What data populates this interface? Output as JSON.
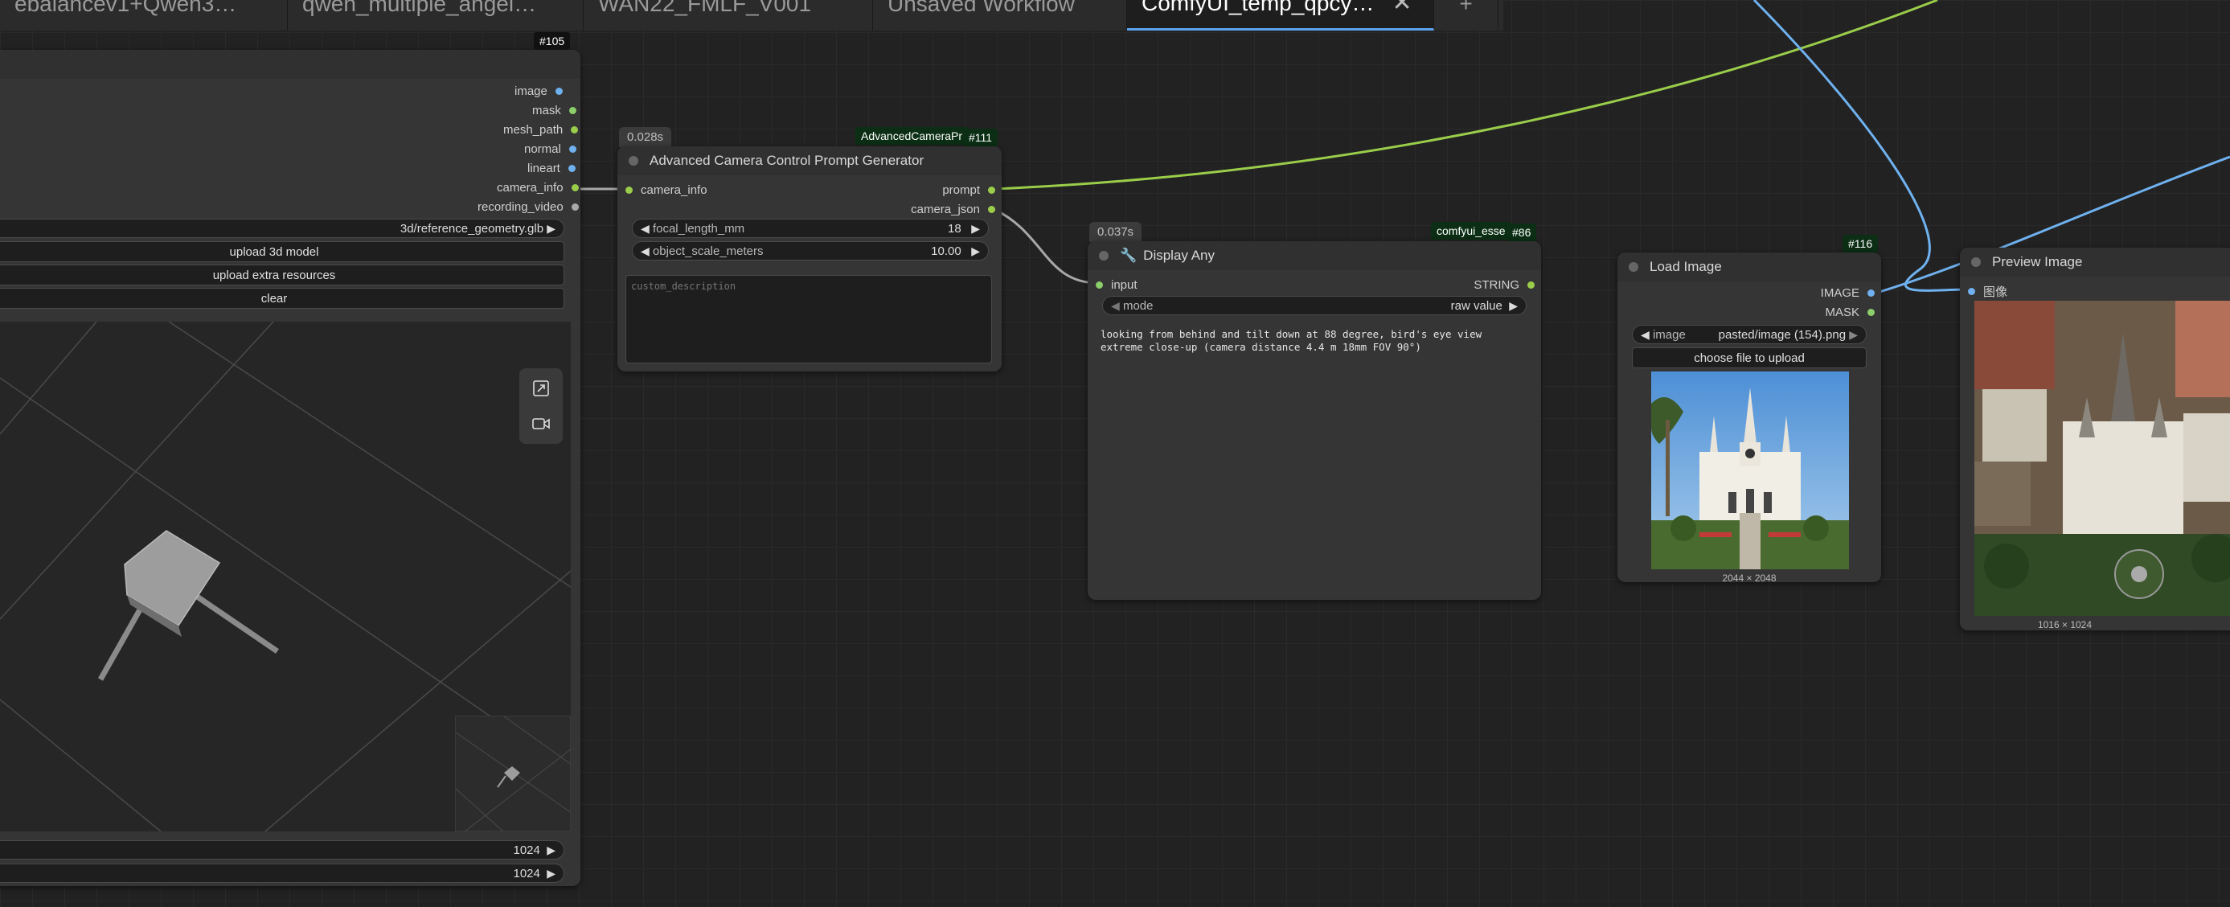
{
  "tabs": [
    {
      "label": "ebalancev1+Qwen3…"
    },
    {
      "label": "qwen_multiple_angel…"
    },
    {
      "label": "WAN22_FMLF_V001"
    },
    {
      "label": "Unsaved Workflow"
    },
    {
      "label": "ComfyUI_temp_qpcy…",
      "active": true
    }
  ],
  "tab_close": "✕",
  "tab_add": "+",
  "node105": {
    "id": "#105",
    "outputs": [
      "image",
      "mask",
      "mesh_path",
      "normal",
      "lineart",
      "camera_info",
      "recording_video"
    ],
    "model_file": "3d/reference_geometry.glb",
    "upload_model": "upload 3d model",
    "upload_extra": "upload extra resources",
    "clear": "clear",
    "width_value": "1024",
    "height_value": "1024"
  },
  "node111": {
    "timing": "0.028s",
    "type_badge": "AdvancedCameraPr",
    "id": "#111",
    "title": "Advanced Camera Control Prompt Generator",
    "input": "camera_info",
    "outputs": [
      "prompt",
      "camera_json"
    ],
    "focal_label": "focal_length_mm",
    "focal_value": "18",
    "scale_label": "object_scale_meters",
    "scale_value": "10.00",
    "textarea_placeholder": "custom_description"
  },
  "node86": {
    "timing": "0.037s",
    "type_badge": "comfyui_esse",
    "id": "#86",
    "title": "Display Any",
    "input": "input",
    "output": "STRING",
    "mode_label": "mode",
    "mode_value": "raw value",
    "text_output": "looking from behind and tilt down at 88 degree, bird's eye view extreme close-up (camera distance 4.4 m 18mm FOV 90°)"
  },
  "node116": {
    "id": "#116",
    "title": "Load Image",
    "outputs": [
      "IMAGE",
      "MASK"
    ],
    "image_label": "image",
    "image_value": "pasted/image (154).png",
    "upload_label": "choose file to upload",
    "dimensions": "2044 × 2048"
  },
  "preview": {
    "title": "Preview Image",
    "input": "图像",
    "dimensions": "1016 × 1024"
  },
  "colors": {
    "green_link": "#9acd4a",
    "blue_link": "#6fb1ef",
    "grey_link": "#a8a8a8"
  }
}
